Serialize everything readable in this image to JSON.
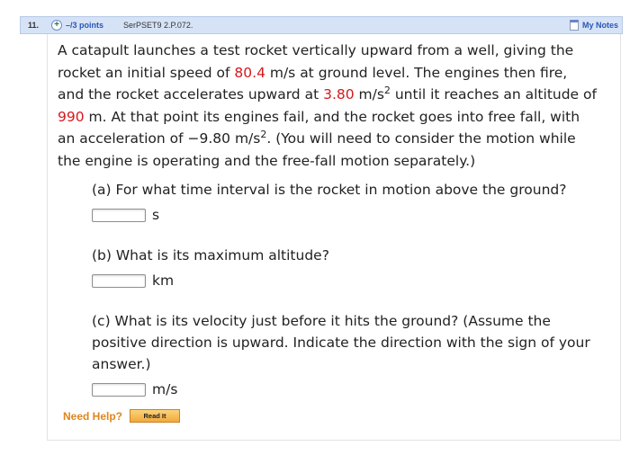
{
  "header": {
    "question_number": "11.",
    "plus_symbol": "+",
    "points": "–/3 points",
    "source": "SerPSET9 2.P.072.",
    "my_notes": "My Notes"
  },
  "problem": {
    "s1": "A catapult launches a test rocket vertically upward from a well, giving the",
    "s2_a": "rocket an initial speed of ",
    "speed": "80.4",
    "s2_b": " m/s at ground level. The engines then fire,",
    "s3_a": "and the rocket accelerates upward at ",
    "accel": "3.80",
    "s3_b": " m/s",
    "s3_sup": "2",
    "s3_c": " until it reaches an altitude of",
    "altitude": "990",
    "s4_b": " m. At that point its engines fail, and the rocket goes into free fall, with",
    "s5_a": "an acceleration of −9.80 m/s",
    "s5_sup": "2",
    "s5_b": ". (You will need to consider the motion while",
    "s6": "the engine is operating and the free-fall motion separately.)"
  },
  "parts": {
    "a": {
      "question": "(a) For what time interval is the rocket in motion above the ground?",
      "unit": "s"
    },
    "b": {
      "question": "(b) What is its maximum altitude?",
      "unit": "km"
    },
    "c": {
      "line1": "(c) What is its velocity just before it hits the ground? (Assume the",
      "line2": "positive direction is upward. Indicate the direction with the sign of your",
      "line3": "answer.)",
      "unit": "m/s"
    }
  },
  "help": {
    "label": "Need Help?",
    "read_button": "Read It"
  }
}
